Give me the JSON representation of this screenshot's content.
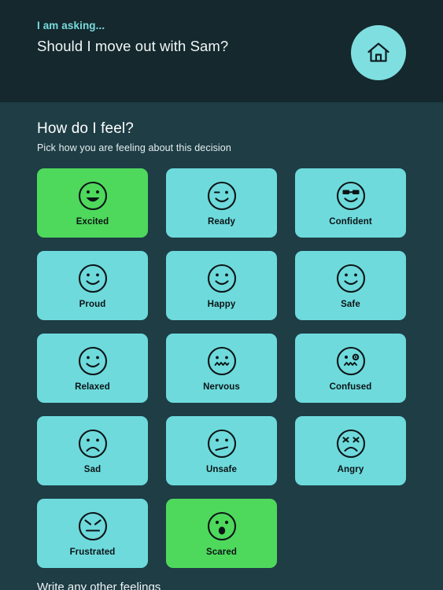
{
  "header": {
    "asking_label": "I am asking...",
    "question": "Should I move out with Sam?",
    "home_icon": "home-icon",
    "background_color": "#14282d",
    "accent_color": "#7fdee0"
  },
  "main": {
    "heading": "How do I feel?",
    "subtitle": "Pick how you are feeling about this decision",
    "background_color": "#1e3d45",
    "tile_color": "#6edadc",
    "tile_selected_color": "#4ed95c",
    "feelings": [
      {
        "label": "Excited",
        "face": "grin-open-mouth-face-icon",
        "selected": true
      },
      {
        "label": "Ready",
        "face": "winking-face-icon",
        "selected": false
      },
      {
        "label": "Confident",
        "face": "sunglasses-face-icon",
        "selected": false
      },
      {
        "label": "Proud",
        "face": "smiling-face-icon",
        "selected": false
      },
      {
        "label": "Happy",
        "face": "smiling-face-icon",
        "selected": false
      },
      {
        "label": "Safe",
        "face": "smiling-face-icon",
        "selected": false
      },
      {
        "label": "Relaxed",
        "face": "smiling-face-icon",
        "selected": false
      },
      {
        "label": "Nervous",
        "face": "wavy-mouth-face-icon",
        "selected": false
      },
      {
        "label": "Confused",
        "face": "confused-face-icon",
        "selected": false
      },
      {
        "label": "Sad",
        "face": "frowning-face-icon",
        "selected": false
      },
      {
        "label": "Unsafe",
        "face": "flat-slant-mouth-face-icon",
        "selected": false
      },
      {
        "label": "Angry",
        "face": "angry-face-icon",
        "selected": false
      },
      {
        "label": "Frustrated",
        "face": "frustrated-face-icon",
        "selected": false
      },
      {
        "label": "Scared",
        "face": "scared-face-icon",
        "selected": true
      }
    ]
  },
  "footer": {
    "write_other_label": "Write any other feelings"
  }
}
